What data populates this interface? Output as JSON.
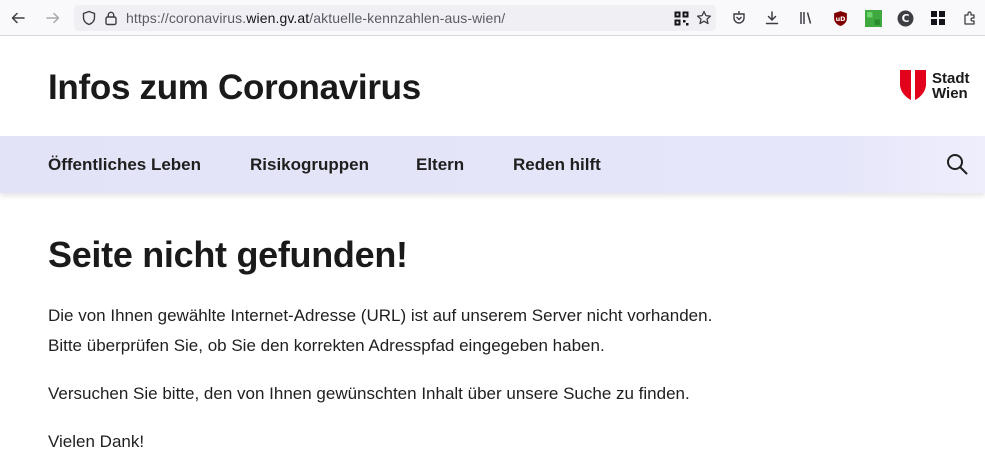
{
  "browser": {
    "url_prefix": "https://coronavirus.",
    "url_domain": "wien.gv.at",
    "url_path": "/aktuelle-kennzahlen-aus-wien/",
    "icons": [
      "back-arrow-icon",
      "forward-arrow-icon",
      "shield-icon",
      "lock-icon",
      "qr-code-icon",
      "bookmark-star-icon",
      "pocket-icon",
      "download-icon",
      "library-icon",
      "ublock-icon",
      "green-extension-icon",
      "c-extension-icon",
      "extensions-grid-icon",
      "puzzle-icon"
    ]
  },
  "header": {
    "title": "Infos zum Coronavirus",
    "logo_line1": "Stadt",
    "logo_line2": "Wien",
    "logo_color": "#e2001a"
  },
  "nav": {
    "items": [
      "Öffentliches Leben",
      "Risikogruppen",
      "Eltern",
      "Reden hilft"
    ],
    "background": "#e5e5f9"
  },
  "main": {
    "heading": "Seite nicht gefunden!",
    "line1": "Die von Ihnen gewählte Internet-Adresse (URL) ist auf unserem Server nicht vorhanden.",
    "line2": "Bitte überprüfen Sie, ob Sie den korrekten Adresspfad eingegeben haben.",
    "line3": "Versuchen Sie bitte, den von Ihnen gewünschten Inhalt über unsere Suche zu finden.",
    "line4": "Vielen Dank!"
  }
}
